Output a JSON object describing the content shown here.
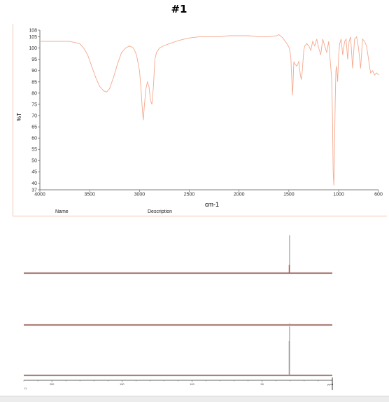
{
  "page_title": "#1",
  "ir_table_headers": {
    "name": "Name",
    "description": "Description"
  },
  "chart_data": [
    {
      "type": "line",
      "title": "",
      "xlabel": "cm-1",
      "ylabel": "%T",
      "xlim": [
        4000,
        600
      ],
      "ylim": [
        37,
        108
      ],
      "x_ticks": [
        4000,
        3500,
        3000,
        2500,
        2000,
        1500,
        1000,
        600
      ],
      "y_ticks": [
        37,
        40,
        45,
        50,
        55,
        60,
        65,
        70,
        75,
        80,
        85,
        90,
        95,
        100,
        105,
        108
      ],
      "grid": false,
      "line_color": "#f4a98e",
      "series": [
        {
          "x": [
            4000,
            3900,
            3800,
            3700,
            3600,
            3560,
            3520,
            3480,
            3440,
            3400,
            3360,
            3330,
            3300,
            3260,
            3220,
            3180,
            3140,
            3100,
            3060,
            3030,
            3000,
            2985,
            2970,
            2962,
            2950,
            2935,
            2920,
            2905,
            2890,
            2875,
            2860,
            2845,
            2830,
            2800,
            2760,
            2700,
            2600,
            2500,
            2400,
            2300,
            2200,
            2100,
            2000,
            1900,
            1800,
            1700,
            1620,
            1600,
            1560,
            1520,
            1495,
            1480,
            1470,
            1465,
            1460,
            1455,
            1450,
            1440,
            1420,
            1400,
            1385,
            1375,
            1365,
            1350,
            1340,
            1320,
            1300,
            1280,
            1260,
            1240,
            1220,
            1200,
            1180,
            1160,
            1140,
            1120,
            1100,
            1090,
            1080,
            1070,
            1062,
            1055,
            1048,
            1042,
            1035,
            1028,
            1020,
            1010,
            1000,
            990,
            975,
            960,
            940,
            925,
            910,
            895,
            880,
            860,
            840,
            820,
            800,
            780,
            760,
            740,
            720,
            700,
            680,
            660,
            640,
            620,
            600
          ],
          "y": [
            103,
            103,
            103,
            103,
            102,
            100,
            97,
            92,
            87,
            83,
            81,
            80.5,
            82,
            87,
            93,
            98,
            100,
            101,
            100,
            97,
            90,
            82,
            72,
            68,
            75,
            82,
            85,
            83,
            77,
            75,
            83,
            95,
            98,
            100,
            101,
            102,
            103.5,
            104.5,
            105,
            105,
            105,
            105.5,
            105.5,
            105.5,
            105,
            105,
            105.5,
            106,
            104.5,
            102,
            100,
            96,
            85,
            79,
            82,
            88,
            94,
            93,
            92,
            94,
            88,
            86,
            90,
            99,
            101,
            102,
            101,
            99,
            103,
            101,
            104,
            100,
            97,
            104,
            101,
            98,
            103,
            97,
            92,
            86,
            70,
            45,
            39,
            55,
            76,
            90,
            92,
            85,
            97,
            102,
            104,
            97,
            103,
            104,
            95,
            103,
            105,
            91,
            104,
            105,
            100,
            91,
            104,
            103,
            101,
            95,
            89,
            90,
            88,
            89,
            88
          ]
        }
      ]
    },
    {
      "type": "line",
      "title": "",
      "xlabel": "",
      "ylabel": "",
      "xlim": [
        220,
        0
      ],
      "axis_ticks": [
        "200",
        "150",
        "100",
        "50",
        "0"
      ],
      "axis_unit": "ppm",
      "axis_side_label": "f1",
      "line_color": "#b5574a",
      "panels": [
        {
          "name": "spectrum-1",
          "peaks": [
            {
              "ppm": 30.5,
              "height": 1.0
            },
            {
              "ppm": 30.7,
              "height": 0.22
            }
          ]
        },
        {
          "name": "spectrum-2",
          "peaks": [
            {
              "ppm": 30.5,
              "height": 0.04
            }
          ]
        },
        {
          "name": "spectrum-3",
          "peaks": [
            {
              "ppm": 30.5,
              "height": 1.0
            },
            {
              "ppm": 30.8,
              "height": 0.7
            }
          ]
        }
      ]
    }
  ]
}
